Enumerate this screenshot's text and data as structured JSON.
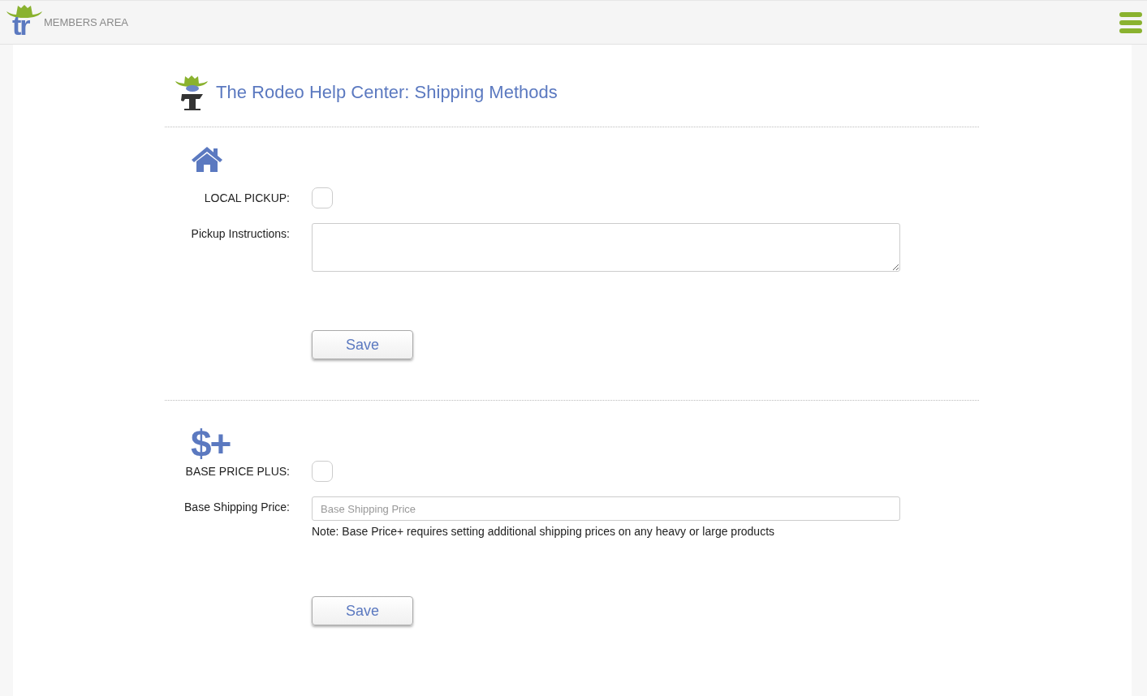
{
  "header": {
    "logo_text": "tr",
    "title": "MEMBERS AREA"
  },
  "page_title": "The Rodeo Help Center: Shipping Methods",
  "sections": [
    {
      "kind": "house",
      "fields": [
        {
          "kind": "checkbox",
          "label": "LOCAL PICKUP:",
          "checked": false
        },
        {
          "kind": "textarea",
          "label": "Pickup Instructions:"
        }
      ],
      "button": "Save"
    },
    {
      "kind": "text",
      "icon_text": "$+",
      "fields": [
        {
          "kind": "checkbox",
          "label": "BASE PRICE PLUS:",
          "checked": false
        },
        {
          "kind": "text",
          "label": "Base Shipping Price:",
          "placeholder": "Base Shipping Price",
          "note": "Note: Base Price+ requires setting additional shipping prices on any heavy or large products"
        }
      ],
      "button": "Save"
    }
  ]
}
